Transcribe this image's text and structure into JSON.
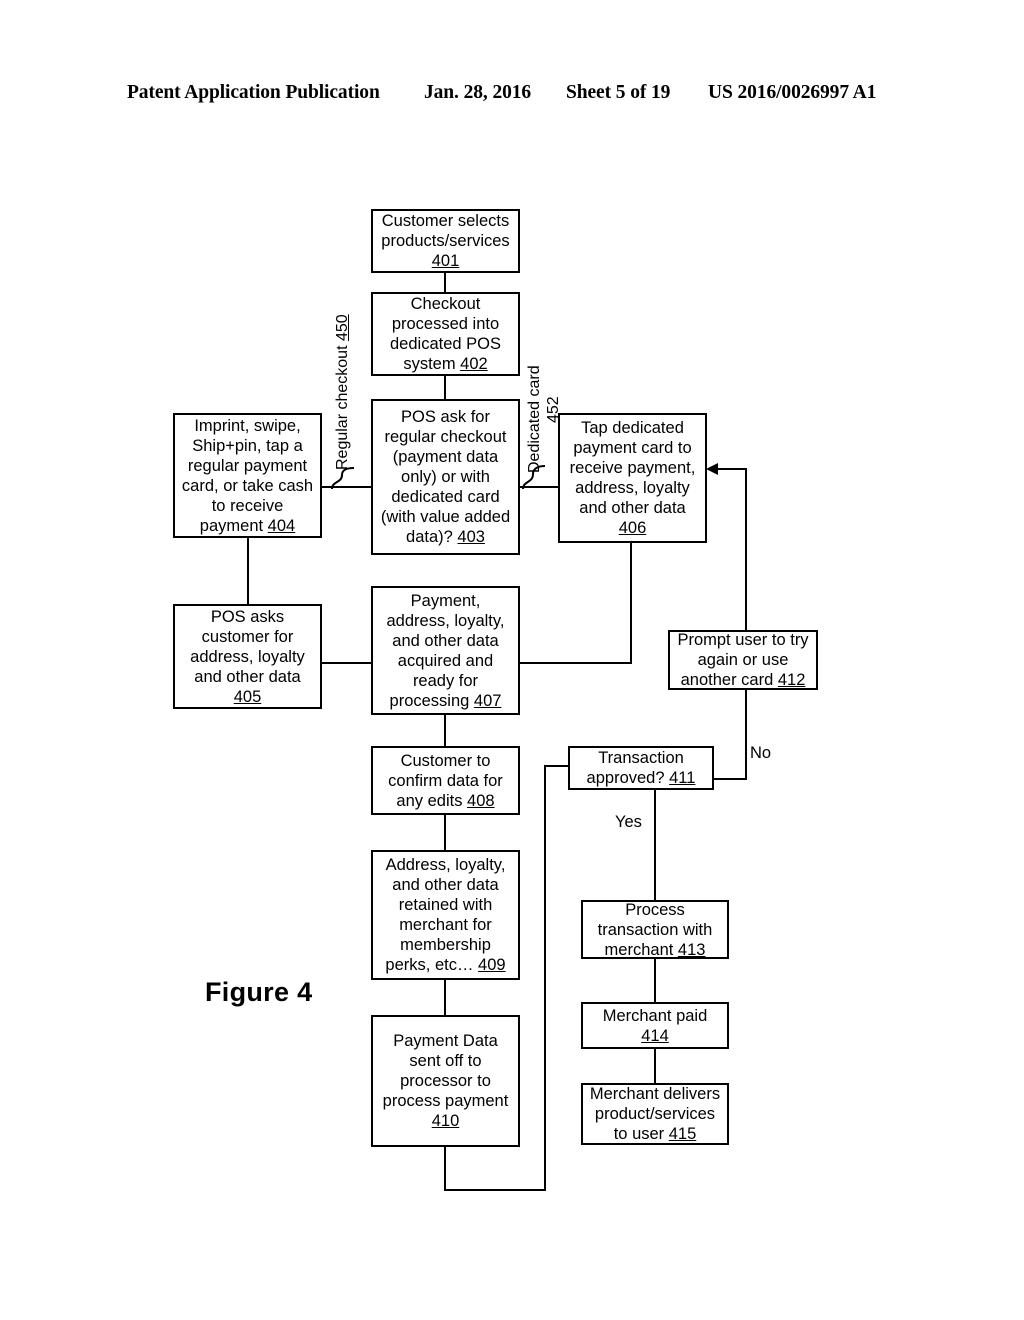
{
  "header": {
    "publication": "Patent Application Publication",
    "date": "Jan. 28, 2016",
    "sheet": "Sheet 5 of 19",
    "number": "US 2016/0026997 A1"
  },
  "figure": {
    "caption": "Figure 4"
  },
  "flowchart": {
    "nodes": [
      {
        "id": "401",
        "text": "Customer selects products/services ",
        "ref": "401"
      },
      {
        "id": "402",
        "text": "Checkout processed into dedicated POS system ",
        "ref": "402"
      },
      {
        "id": "403",
        "text": "POS ask for regular checkout (payment data only) or with dedicated card (with value added data)? ",
        "ref": "403"
      },
      {
        "id": "404",
        "text": "Imprint, swipe, Ship+pin, tap a regular payment card, or take cash to receive payment ",
        "ref": "404"
      },
      {
        "id": "405",
        "text": "POS asks customer for address, loyalty and other data ",
        "ref": "405"
      },
      {
        "id": "406",
        "text": "Tap dedicated payment card to receive payment, address, loyalty and other data ",
        "ref": "406"
      },
      {
        "id": "407",
        "text": "Payment, address, loyalty, and other data acquired and ready for processing ",
        "ref": "407"
      },
      {
        "id": "408",
        "text": "Customer to confirm data for any edits ",
        "ref": "408"
      },
      {
        "id": "409",
        "text": "Address, loyalty, and other data retained with merchant for membership perks, etc… ",
        "ref": "409"
      },
      {
        "id": "410",
        "text": "Payment Data sent off to processor to process payment ",
        "ref": "410"
      },
      {
        "id": "411",
        "text": "Transaction approved? ",
        "ref": "411"
      },
      {
        "id": "412",
        "text": "Prompt user to try again or use another card ",
        "ref": "412"
      },
      {
        "id": "413",
        "text": "Process transaction with merchant ",
        "ref": "413"
      },
      {
        "id": "414",
        "text": "Merchant paid ",
        "ref": "414"
      },
      {
        "id": "415",
        "text": "Merchant delivers product/services to user ",
        "ref": "415"
      }
    ],
    "branch_labels": {
      "regular_checkout": "Regular checkout ",
      "regular_checkout_ref": "450",
      "dedicated_card": "Dedicated card",
      "dedicated_card_ref": "452",
      "no": "No",
      "yes": "Yes"
    }
  },
  "colors": {
    "ink": "#000000",
    "paper": "#ffffff"
  }
}
